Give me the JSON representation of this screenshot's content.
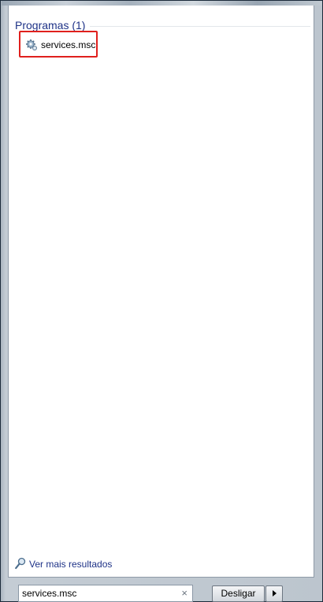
{
  "results": {
    "group_header": "Programas (1)",
    "items": [
      {
        "label": "services.msc",
        "icon": "services-gear-icon",
        "highlighted": true
      }
    ]
  },
  "more_results": {
    "label": "Ver mais resultados",
    "icon": "magnifier-icon"
  },
  "search": {
    "value": "services.msc",
    "clear_icon": "clear-x-icon"
  },
  "shutdown": {
    "label": "Desligar",
    "arrow_icon": "arrow-right-icon"
  },
  "colors": {
    "highlight_border": "#e0201d",
    "header_text": "#1e3287"
  }
}
